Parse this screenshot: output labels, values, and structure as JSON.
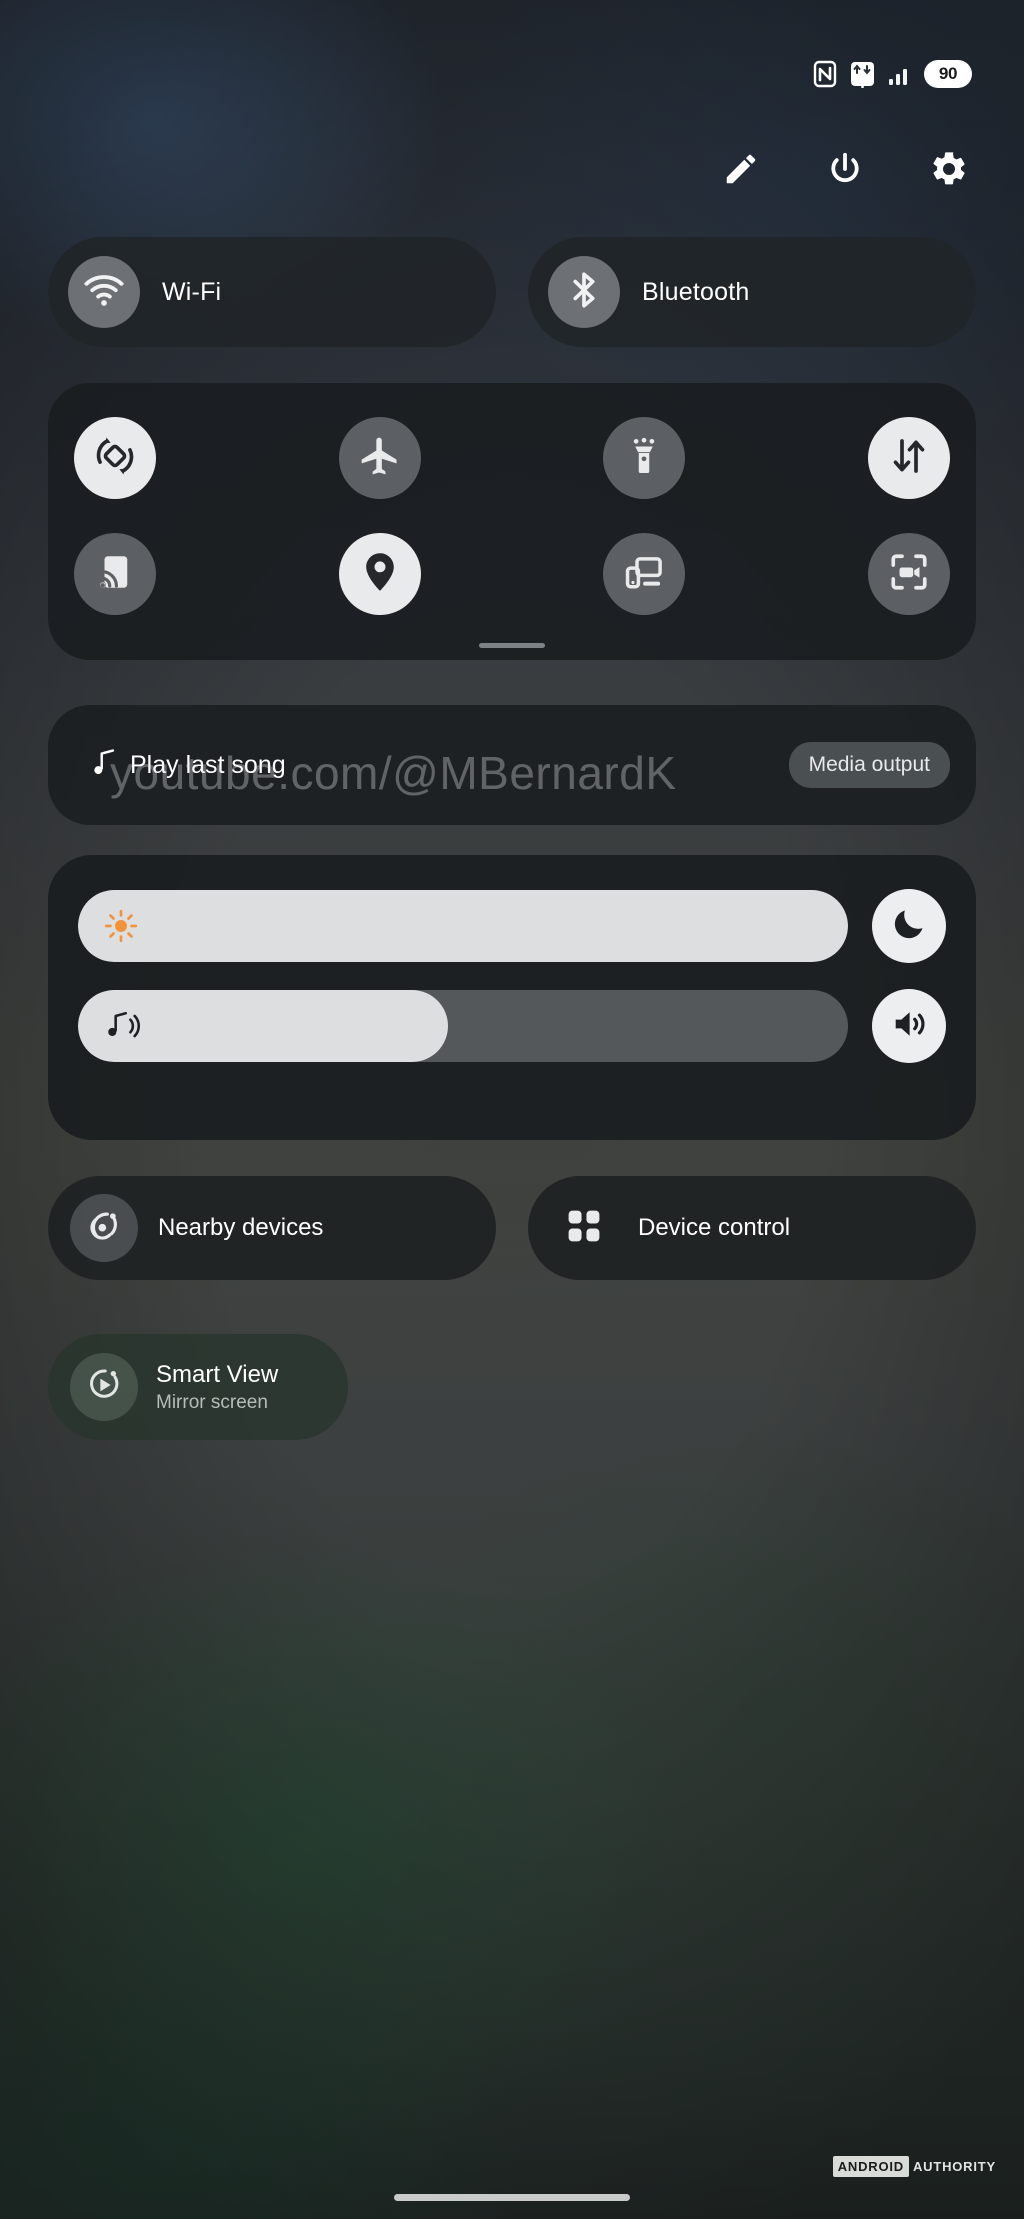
{
  "statusbar": {
    "battery_percent": "90",
    "icons": [
      "nfc-icon",
      "network-transfer-icon",
      "signal-bars-icon"
    ]
  },
  "header": {
    "actions": [
      {
        "name": "edit-button",
        "icon": "pencil-icon"
      },
      {
        "name": "power-button",
        "icon": "power-icon"
      },
      {
        "name": "settings-button",
        "icon": "gear-icon"
      }
    ]
  },
  "connectivity": {
    "wifi": {
      "label": "Wi-Fi",
      "icon": "wifi-icon",
      "state": "off"
    },
    "bluetooth": {
      "label": "Bluetooth",
      "icon": "bluetooth-icon",
      "state": "off"
    }
  },
  "toggles": {
    "row1": [
      {
        "name": "auto-rotate-toggle",
        "icon": "auto-rotate-icon",
        "state": "on"
      },
      {
        "name": "airplane-mode-toggle",
        "icon": "airplane-icon",
        "state": "off"
      },
      {
        "name": "flashlight-toggle",
        "icon": "flashlight-icon",
        "state": "off"
      },
      {
        "name": "mobile-data-toggle",
        "icon": "data-transfer-icon",
        "state": "on"
      }
    ],
    "row2": [
      {
        "name": "cast-toggle",
        "icon": "screen-cast-icon",
        "state": "off"
      },
      {
        "name": "location-toggle",
        "icon": "location-pin-icon",
        "state": "on"
      },
      {
        "name": "multi-device-toggle",
        "icon": "multi-device-icon",
        "state": "off"
      },
      {
        "name": "screen-recorder-toggle",
        "icon": "screen-record-icon",
        "state": "off"
      }
    ]
  },
  "media": {
    "title": "Play last song",
    "icon": "music-note-icon",
    "output_label": "Media output"
  },
  "sliders": {
    "brightness": {
      "icon": "sun-icon",
      "value_percent": 100,
      "side_button": {
        "name": "dark-mode-button",
        "icon": "moon-icon"
      }
    },
    "volume": {
      "icon": "music-volume-icon",
      "value_percent": 48,
      "side_button": {
        "name": "sound-settings-button",
        "icon": "speaker-icon"
      }
    }
  },
  "shortcuts": [
    {
      "name": "nearby-devices-button",
      "label": "Nearby devices",
      "icon": "nearby-share-icon"
    },
    {
      "name": "device-control-button",
      "label": "Device control",
      "icon": "grid-squares-icon"
    }
  ],
  "smart_view": {
    "title": "Smart View",
    "subtitle": "Mirror screen",
    "icon": "smart-view-icon"
  },
  "watermarks": {
    "channel_url": "youtube.com/@MBernardK",
    "publisher_primary": "ANDROID",
    "publisher_secondary": "AUTHORITY"
  }
}
